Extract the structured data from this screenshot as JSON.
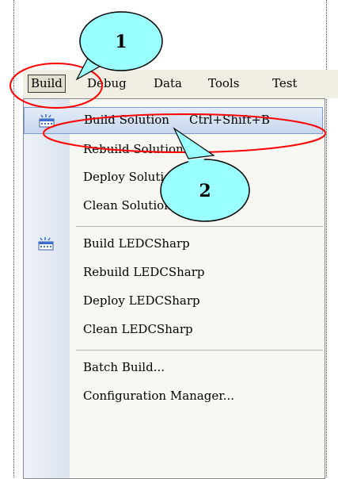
{
  "menubar": {
    "items": [
      {
        "label": "Build"
      },
      {
        "label": "Debug"
      },
      {
        "label": "Data"
      },
      {
        "label": "Tools"
      },
      {
        "label": "Test"
      }
    ]
  },
  "dropdown": {
    "items": [
      {
        "label": "Build Solution",
        "shortcut": "Ctrl+Shift+B",
        "icon": "build-solution-icon",
        "highlighted": true
      },
      {
        "label": "Rebuild Solution"
      },
      {
        "label": "Deploy Solution"
      },
      {
        "label": "Clean Solution"
      },
      {
        "label": "Build LEDCSharp",
        "icon": "build-project-icon"
      },
      {
        "label": "Rebuild LEDCSharp"
      },
      {
        "label": "Deploy LEDCSharp"
      },
      {
        "label": "Clean LEDCSharp"
      },
      {
        "label": "Batch Build..."
      },
      {
        "label": "Configuration Manager..."
      }
    ]
  },
  "annotations": {
    "callout_1": "1",
    "callout_2": "2",
    "callout_color": "#99ffff",
    "ellipse_color": "#ff0000"
  }
}
